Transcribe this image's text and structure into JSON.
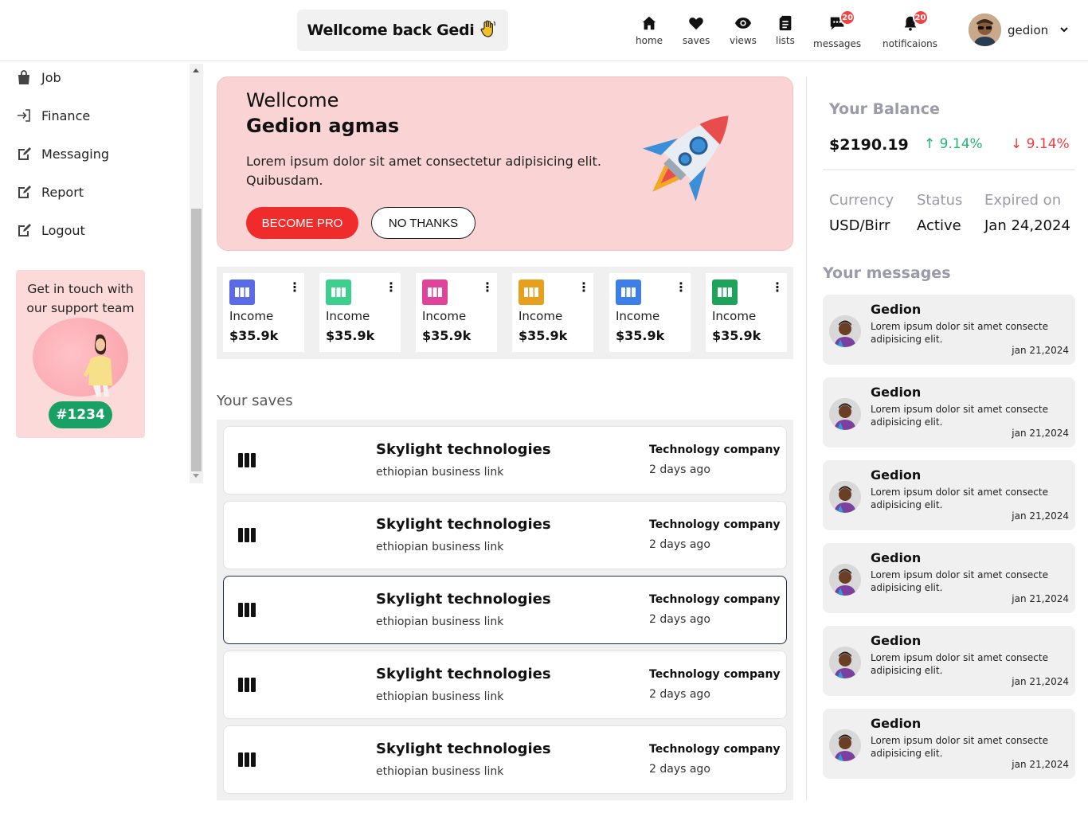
{
  "header": {
    "welcome": "Wellcome back Gedi",
    "nav": [
      {
        "label": "home",
        "icon": "home-icon"
      },
      {
        "label": "saves",
        "icon": "heart-icon"
      },
      {
        "label": "views",
        "icon": "eye-icon"
      },
      {
        "label": "lists",
        "icon": "list-icon"
      },
      {
        "label": "messages",
        "icon": "chat-icon",
        "badge": "20"
      },
      {
        "label": "notificaions",
        "icon": "bell-icon",
        "badge": "20"
      }
    ],
    "user_name": "gedion"
  },
  "sidebar": {
    "items": [
      {
        "label": "Job",
        "icon": "bag-icon"
      },
      {
        "label": "Finance",
        "icon": "login-icon"
      },
      {
        "label": "Messaging",
        "icon": "edit-icon"
      },
      {
        "label": "Report",
        "icon": "edit-icon"
      },
      {
        "label": "Logout",
        "icon": "edit-icon"
      }
    ],
    "support": {
      "text": "Get in touch with our support team",
      "tag": "#1234"
    }
  },
  "hero": {
    "line1": "Wellcome",
    "line2": "Gedion agmas",
    "text": "Lorem ipsum dolor sit amet consectetur adipisicing elit. Quibusdam.",
    "primary_button": "BECOME PRO",
    "secondary_button": "NO THANKS"
  },
  "stats": [
    {
      "label": "Income",
      "value": "$35.9k",
      "color": "#5b6be8"
    },
    {
      "label": "Income",
      "value": "$35.9k",
      "color": "#3ccf8e"
    },
    {
      "label": "Income",
      "value": "$35.9k",
      "color": "#e0449a"
    },
    {
      "label": "Income",
      "value": "$35.9k",
      "color": "#e6a01d"
    },
    {
      "label": "Income",
      "value": "$35.9k",
      "color": "#3d7ee8"
    },
    {
      "label": "Income",
      "value": "$35.9k",
      "color": "#1ea35a"
    }
  ],
  "saves": {
    "title": "Your saves",
    "items": [
      {
        "name": "Skylight technologies",
        "sub": "ethiopian business link",
        "category": "Technology company",
        "time": "2 days ago"
      },
      {
        "name": "Skylight technologies",
        "sub": "ethiopian business link",
        "category": "Technology company",
        "time": "2 days ago"
      },
      {
        "name": "Skylight technologies",
        "sub": "ethiopian business link",
        "category": "Technology company",
        "time": "2 days ago"
      },
      {
        "name": "Skylight technologies",
        "sub": "ethiopian business link",
        "category": "Technology company",
        "time": "2 days ago"
      },
      {
        "name": "Skylight technologies",
        "sub": "ethiopian business link",
        "category": "Technology company",
        "time": "2 days ago"
      }
    ]
  },
  "balance": {
    "title": "Your Balance",
    "amount": "$2190.19",
    "up": "9.14%",
    "down": "9.14%",
    "meta": [
      {
        "head": "Currency",
        "value": "USD/Birr"
      },
      {
        "head": "Status",
        "value": "Active"
      },
      {
        "head": "Expired on",
        "value": "Jan 24,2024"
      }
    ]
  },
  "messages": {
    "title": "Your messages",
    "items": [
      {
        "name": "Gedion",
        "body": "Lorem ipsum dolor sit amet consecte adipisicing elit.",
        "date": "jan 21,2024"
      },
      {
        "name": "Gedion",
        "body": "Lorem ipsum dolor sit amet consecte adipisicing elit.",
        "date": "jan 21,2024"
      },
      {
        "name": "Gedion",
        "body": "Lorem ipsum dolor sit amet consecte adipisicing elit.",
        "date": "jan 21,2024"
      },
      {
        "name": "Gedion",
        "body": "Lorem ipsum dolor sit amet consecte adipisicing elit.",
        "date": "jan 21,2024"
      },
      {
        "name": "Gedion",
        "body": "Lorem ipsum dolor sit amet consecte adipisicing elit.",
        "date": "jan 21,2024"
      },
      {
        "name": "Gedion",
        "body": "Lorem ipsum dolor sit amet consecte adipisicing elit.",
        "date": "jan 21,2024"
      }
    ]
  }
}
